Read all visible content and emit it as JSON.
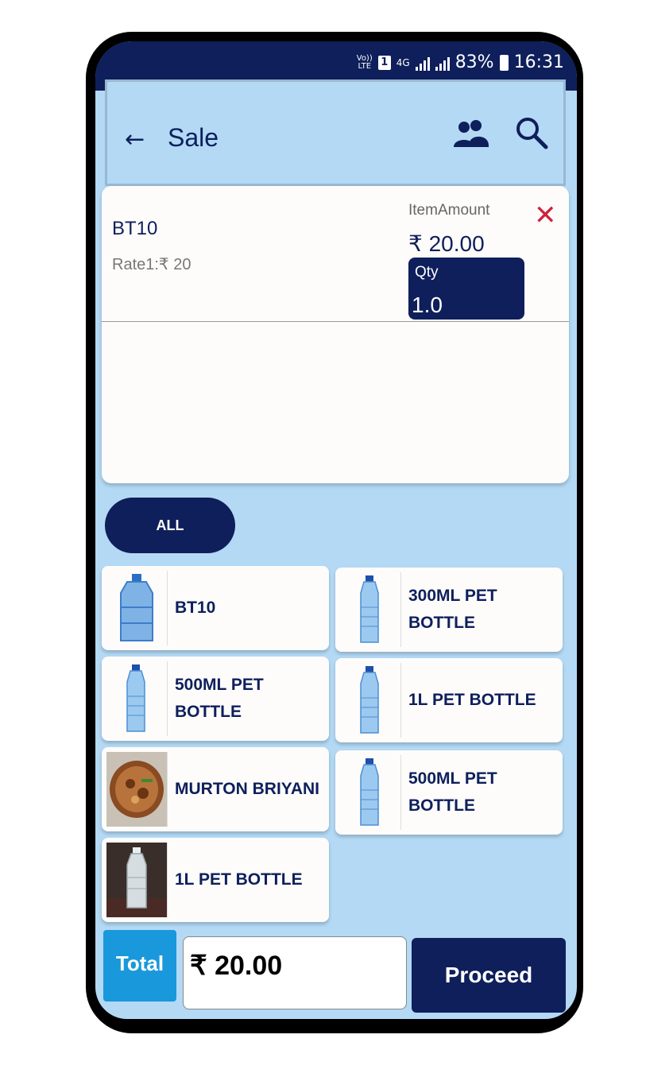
{
  "status_bar": {
    "volte_top": "Vo))",
    "volte_bottom": "LTE",
    "sim": "1",
    "network": "4G",
    "battery": "83%",
    "time": "16:31"
  },
  "header": {
    "back_icon": "arrow-left-icon",
    "title": "Sale",
    "customers_icon": "people-icon",
    "search_icon": "search-icon"
  },
  "cart": {
    "items": [
      {
        "name": "BT10",
        "rate": "Rate1:₹ 20",
        "amount_label": "ItemAmount",
        "amount": "₹ 20.00",
        "qty_label": "Qty",
        "qty": "1.0"
      }
    ]
  },
  "category": {
    "label": "ALL"
  },
  "products": [
    {
      "name": "BT10",
      "thumb": "water-can"
    },
    {
      "name": "300ML PET BOTTLE",
      "thumb": "bottle"
    },
    {
      "name": "500ML PET BOTTLE",
      "thumb": "bottle"
    },
    {
      "name": "1L PET BOTTLE",
      "thumb": "bottle"
    },
    {
      "name": "MURTON BRIYANI",
      "thumb": "biryani"
    },
    {
      "name": "500ML PET BOTTLE",
      "thumb": "bottle"
    },
    {
      "name": "1L PET BOTTLE",
      "thumb": "bottle-photo"
    }
  ],
  "footer": {
    "total_label": "Total",
    "total_value": "₹  20.00",
    "proceed_label": "Proceed"
  },
  "colors": {
    "primary": "#0e1f5b",
    "background": "#b3d9f5",
    "accent": "#1a98dc",
    "danger": "#d0213b"
  }
}
